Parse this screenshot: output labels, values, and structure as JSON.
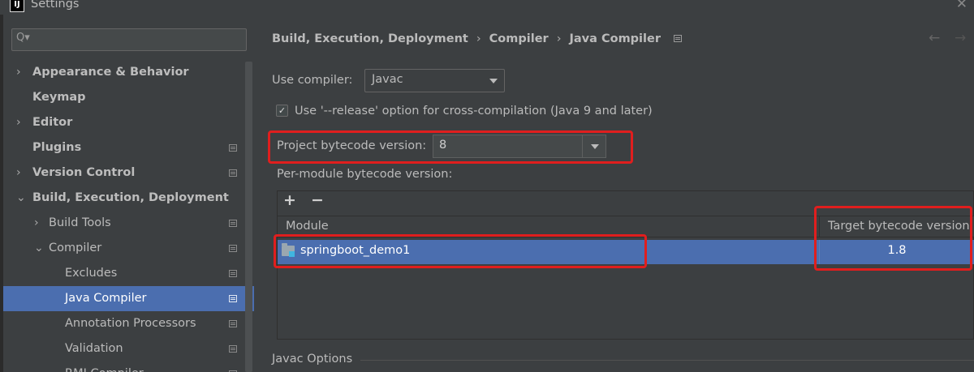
{
  "window": {
    "title": "Settings",
    "logo_text": "IJ",
    "close_glyph": "✕"
  },
  "search": {
    "icon": "search-icon",
    "value": "",
    "glyph": "Q▾"
  },
  "sidebar": {
    "items": [
      {
        "label": "Appearance & Behavior",
        "bold": true,
        "arrow": "›",
        "level": 0
      },
      {
        "label": "Keymap",
        "bold": true,
        "arrow": "",
        "level": 0
      },
      {
        "label": "Editor",
        "bold": true,
        "arrow": "›",
        "level": 0
      },
      {
        "label": "Plugins",
        "bold": true,
        "arrow": "",
        "level": 0,
        "project_icon": true
      },
      {
        "label": "Version Control",
        "bold": true,
        "arrow": "›",
        "level": 0,
        "project_icon": true
      },
      {
        "label": "Build, Execution, Deployment",
        "bold": true,
        "arrow": "⌄",
        "level": 0
      },
      {
        "label": "Build Tools",
        "bold": false,
        "arrow": "›",
        "level": 1,
        "project_icon": true
      },
      {
        "label": "Compiler",
        "bold": false,
        "arrow": "⌄",
        "level": 1,
        "project_icon": true
      },
      {
        "label": "Excludes",
        "bold": false,
        "arrow": "",
        "level": 2,
        "project_icon": true
      },
      {
        "label": "Java Compiler",
        "bold": false,
        "arrow": "",
        "level": 2,
        "project_icon": true,
        "selected": true
      },
      {
        "label": "Annotation Processors",
        "bold": false,
        "arrow": "",
        "level": 2,
        "project_icon": true
      },
      {
        "label": "Validation",
        "bold": false,
        "arrow": "",
        "level": 2,
        "project_icon": true
      },
      {
        "label": "RMI Compiler",
        "bold": false,
        "arrow": "",
        "level": 2,
        "project_icon": true
      }
    ]
  },
  "breadcrumb": {
    "part1": "Build, Execution, Deployment",
    "part2": "Compiler",
    "part3": "Java Compiler",
    "separator": "›"
  },
  "nav": {
    "back": "←",
    "forward": "→"
  },
  "use_compiler": {
    "label": "Use compiler:",
    "value": "Javac"
  },
  "release_option": {
    "label": "Use '--release' option for cross-compilation (Java 9 and later)",
    "checked": true,
    "check_glyph": "✓"
  },
  "project_bytecode": {
    "label": "Project bytecode version:",
    "value": "8"
  },
  "per_module": {
    "label": "Per-module bytecode version:",
    "add": "+",
    "remove": "−",
    "columns": [
      "Module",
      "Target bytecode version"
    ],
    "rows": [
      {
        "module": "springboot_demo1",
        "target": "1.8"
      }
    ]
  },
  "javac_options": {
    "title": "Javac Options"
  },
  "colors": {
    "background": "#3c3f41",
    "selection": "#4b6eaf",
    "highlight": "#e01e1e"
  }
}
